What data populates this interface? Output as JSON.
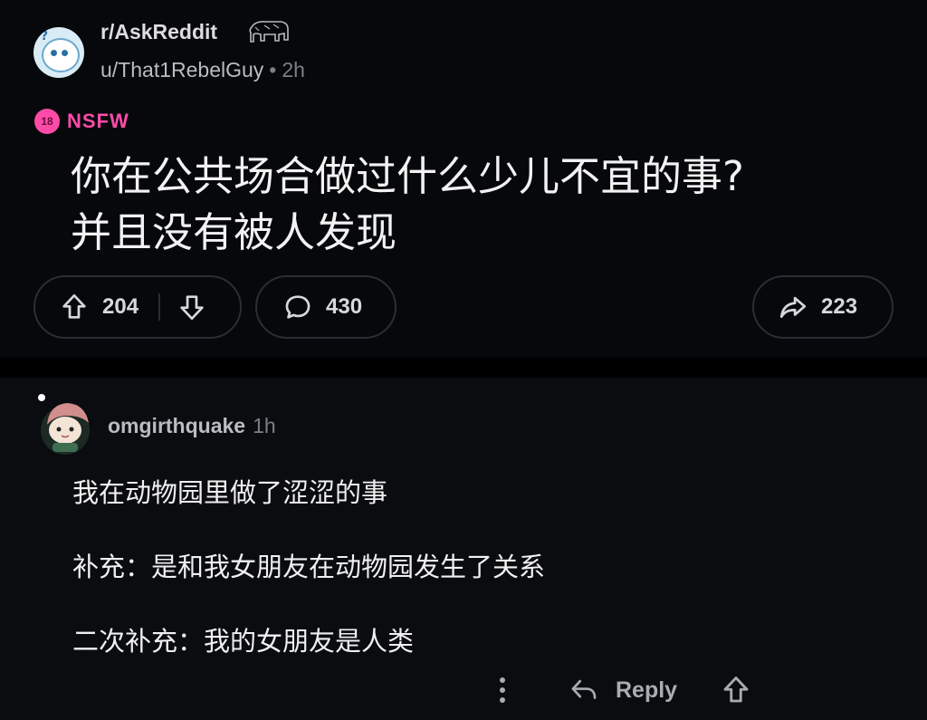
{
  "post": {
    "subreddit": "r/AskReddit",
    "author": "u/That1RebelGuy",
    "separator": "•",
    "age": "2h",
    "nsfw_badge": "18",
    "nsfw_label": "NSFW",
    "title_line1": "你在公共场合做过什么少儿不宜的事?",
    "title_line2": "并且没有被人发现",
    "upvotes": "204",
    "comments": "430",
    "shares": "223"
  },
  "comment": {
    "author": "omgirthquake",
    "age": "1h",
    "lines": [
      "我在动物园里做了涩涩的事",
      "补充：是和我女朋友在动物园发生了关系",
      "二次补充：我的女朋友是人类"
    ],
    "reply_label": "Reply"
  },
  "icons": {
    "subreddit_avatar": "snoo-avatar-icon",
    "subreddit_badge": "elephant-icon",
    "upvote": "arrow-up-icon",
    "downvote": "arrow-down-icon",
    "comments": "speech-bubble-icon",
    "share": "share-arrow-icon",
    "more": "vertical-dots-icon",
    "reply": "reply-arrow-icon"
  },
  "colors": {
    "nsfw": "#ff4ba8",
    "background": "#06080b",
    "border": "#2b2e33"
  }
}
